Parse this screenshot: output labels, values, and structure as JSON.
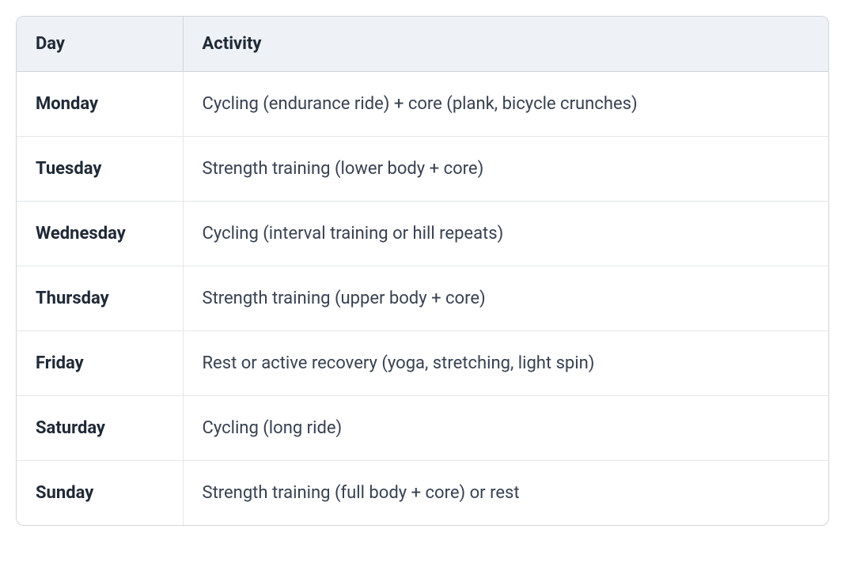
{
  "table": {
    "headers": {
      "day": "Day",
      "activity": "Activity"
    },
    "rows": [
      {
        "day": "Monday",
        "activity": "Cycling (endurance ride) + core (plank, bicycle crunches)"
      },
      {
        "day": "Tuesday",
        "activity": "Strength training (lower body + core)"
      },
      {
        "day": "Wednesday",
        "activity": "Cycling (interval training or hill repeats)"
      },
      {
        "day": "Thursday",
        "activity": "Strength training (upper body + core)"
      },
      {
        "day": "Friday",
        "activity": "Rest or active recovery (yoga, stretching, light spin)"
      },
      {
        "day": "Saturday",
        "activity": "Cycling (long ride)"
      },
      {
        "day": "Sunday",
        "activity": "Strength training (full body + core) or rest"
      }
    ]
  }
}
